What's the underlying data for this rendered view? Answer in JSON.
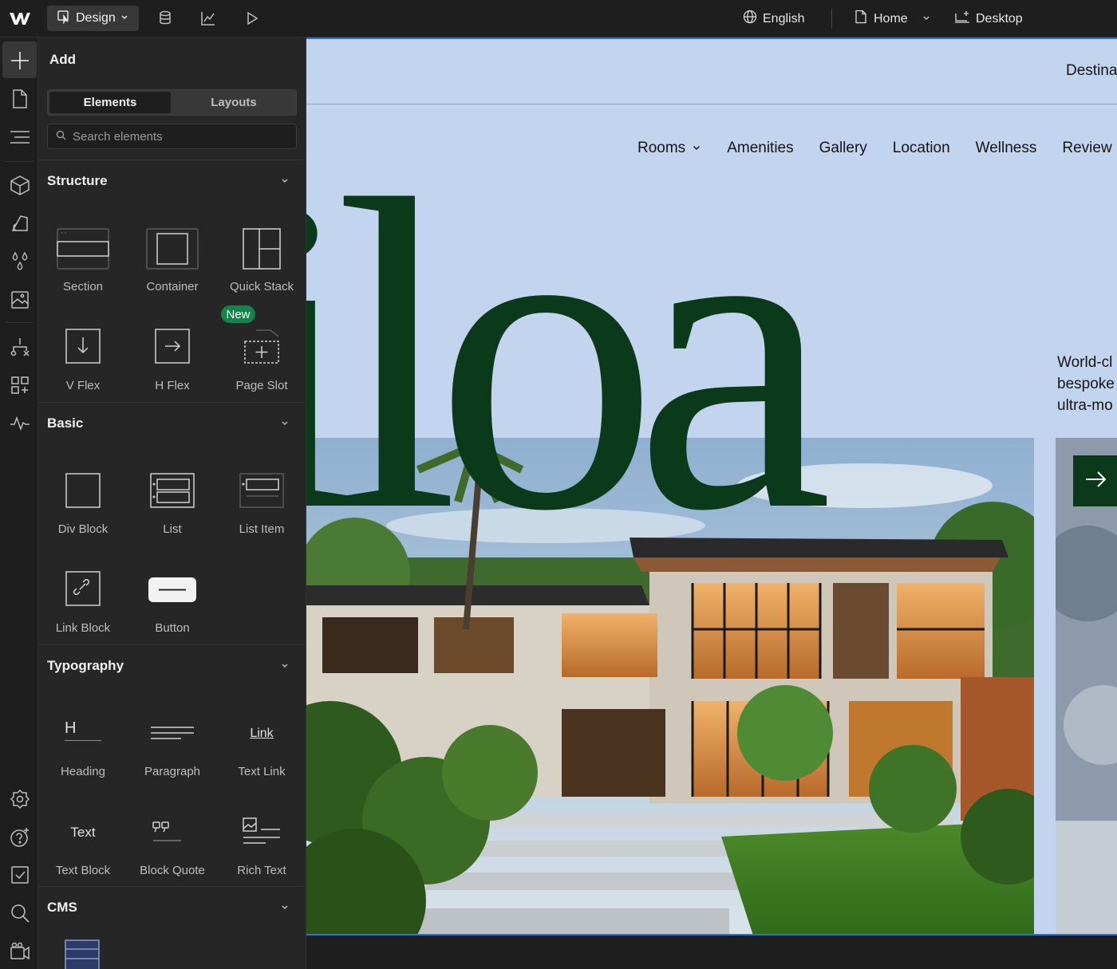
{
  "topbar": {
    "mode_label": "Design",
    "language": "English",
    "page": "Home",
    "device": "Desktop"
  },
  "panel": {
    "title": "Add",
    "tabs": [
      "Elements",
      "Layouts"
    ],
    "search_placeholder": "Search elements",
    "sections": {
      "structure": {
        "title": "Structure",
        "items": [
          "Section",
          "Container",
          "Quick Stack",
          "V Flex",
          "H Flex",
          "Page Slot"
        ],
        "badge": "New"
      },
      "basic": {
        "title": "Basic",
        "items": [
          "Div Block",
          "List",
          "List Item",
          "Link Block",
          "Button"
        ]
      },
      "typography": {
        "title": "Typography",
        "items": [
          "Heading",
          "Paragraph",
          "Text Link",
          "Text Block",
          "Block Quote",
          "Rich Text"
        ],
        "glyph_heading": "H",
        "glyph_link": "Link",
        "glyph_text": "Text"
      },
      "cms": {
        "title": "CMS"
      }
    }
  },
  "site": {
    "top_right": "Destina",
    "nav": [
      "Rooms",
      "Amenities",
      "Gallery",
      "Location",
      "Wellness",
      "Review"
    ],
    "hero_word": "iloa",
    "side_lines": [
      "World-cl",
      "bespoke",
      "ultra-mo"
    ],
    "brand_green": "#0b3a1a",
    "canvas_bg": "#c2d4ee"
  },
  "colors": {
    "editor_bg": "#1e1e1e",
    "panel_bg": "#262626",
    "selection_blue": "#2f6fd8",
    "badge_green": "#14854a"
  }
}
